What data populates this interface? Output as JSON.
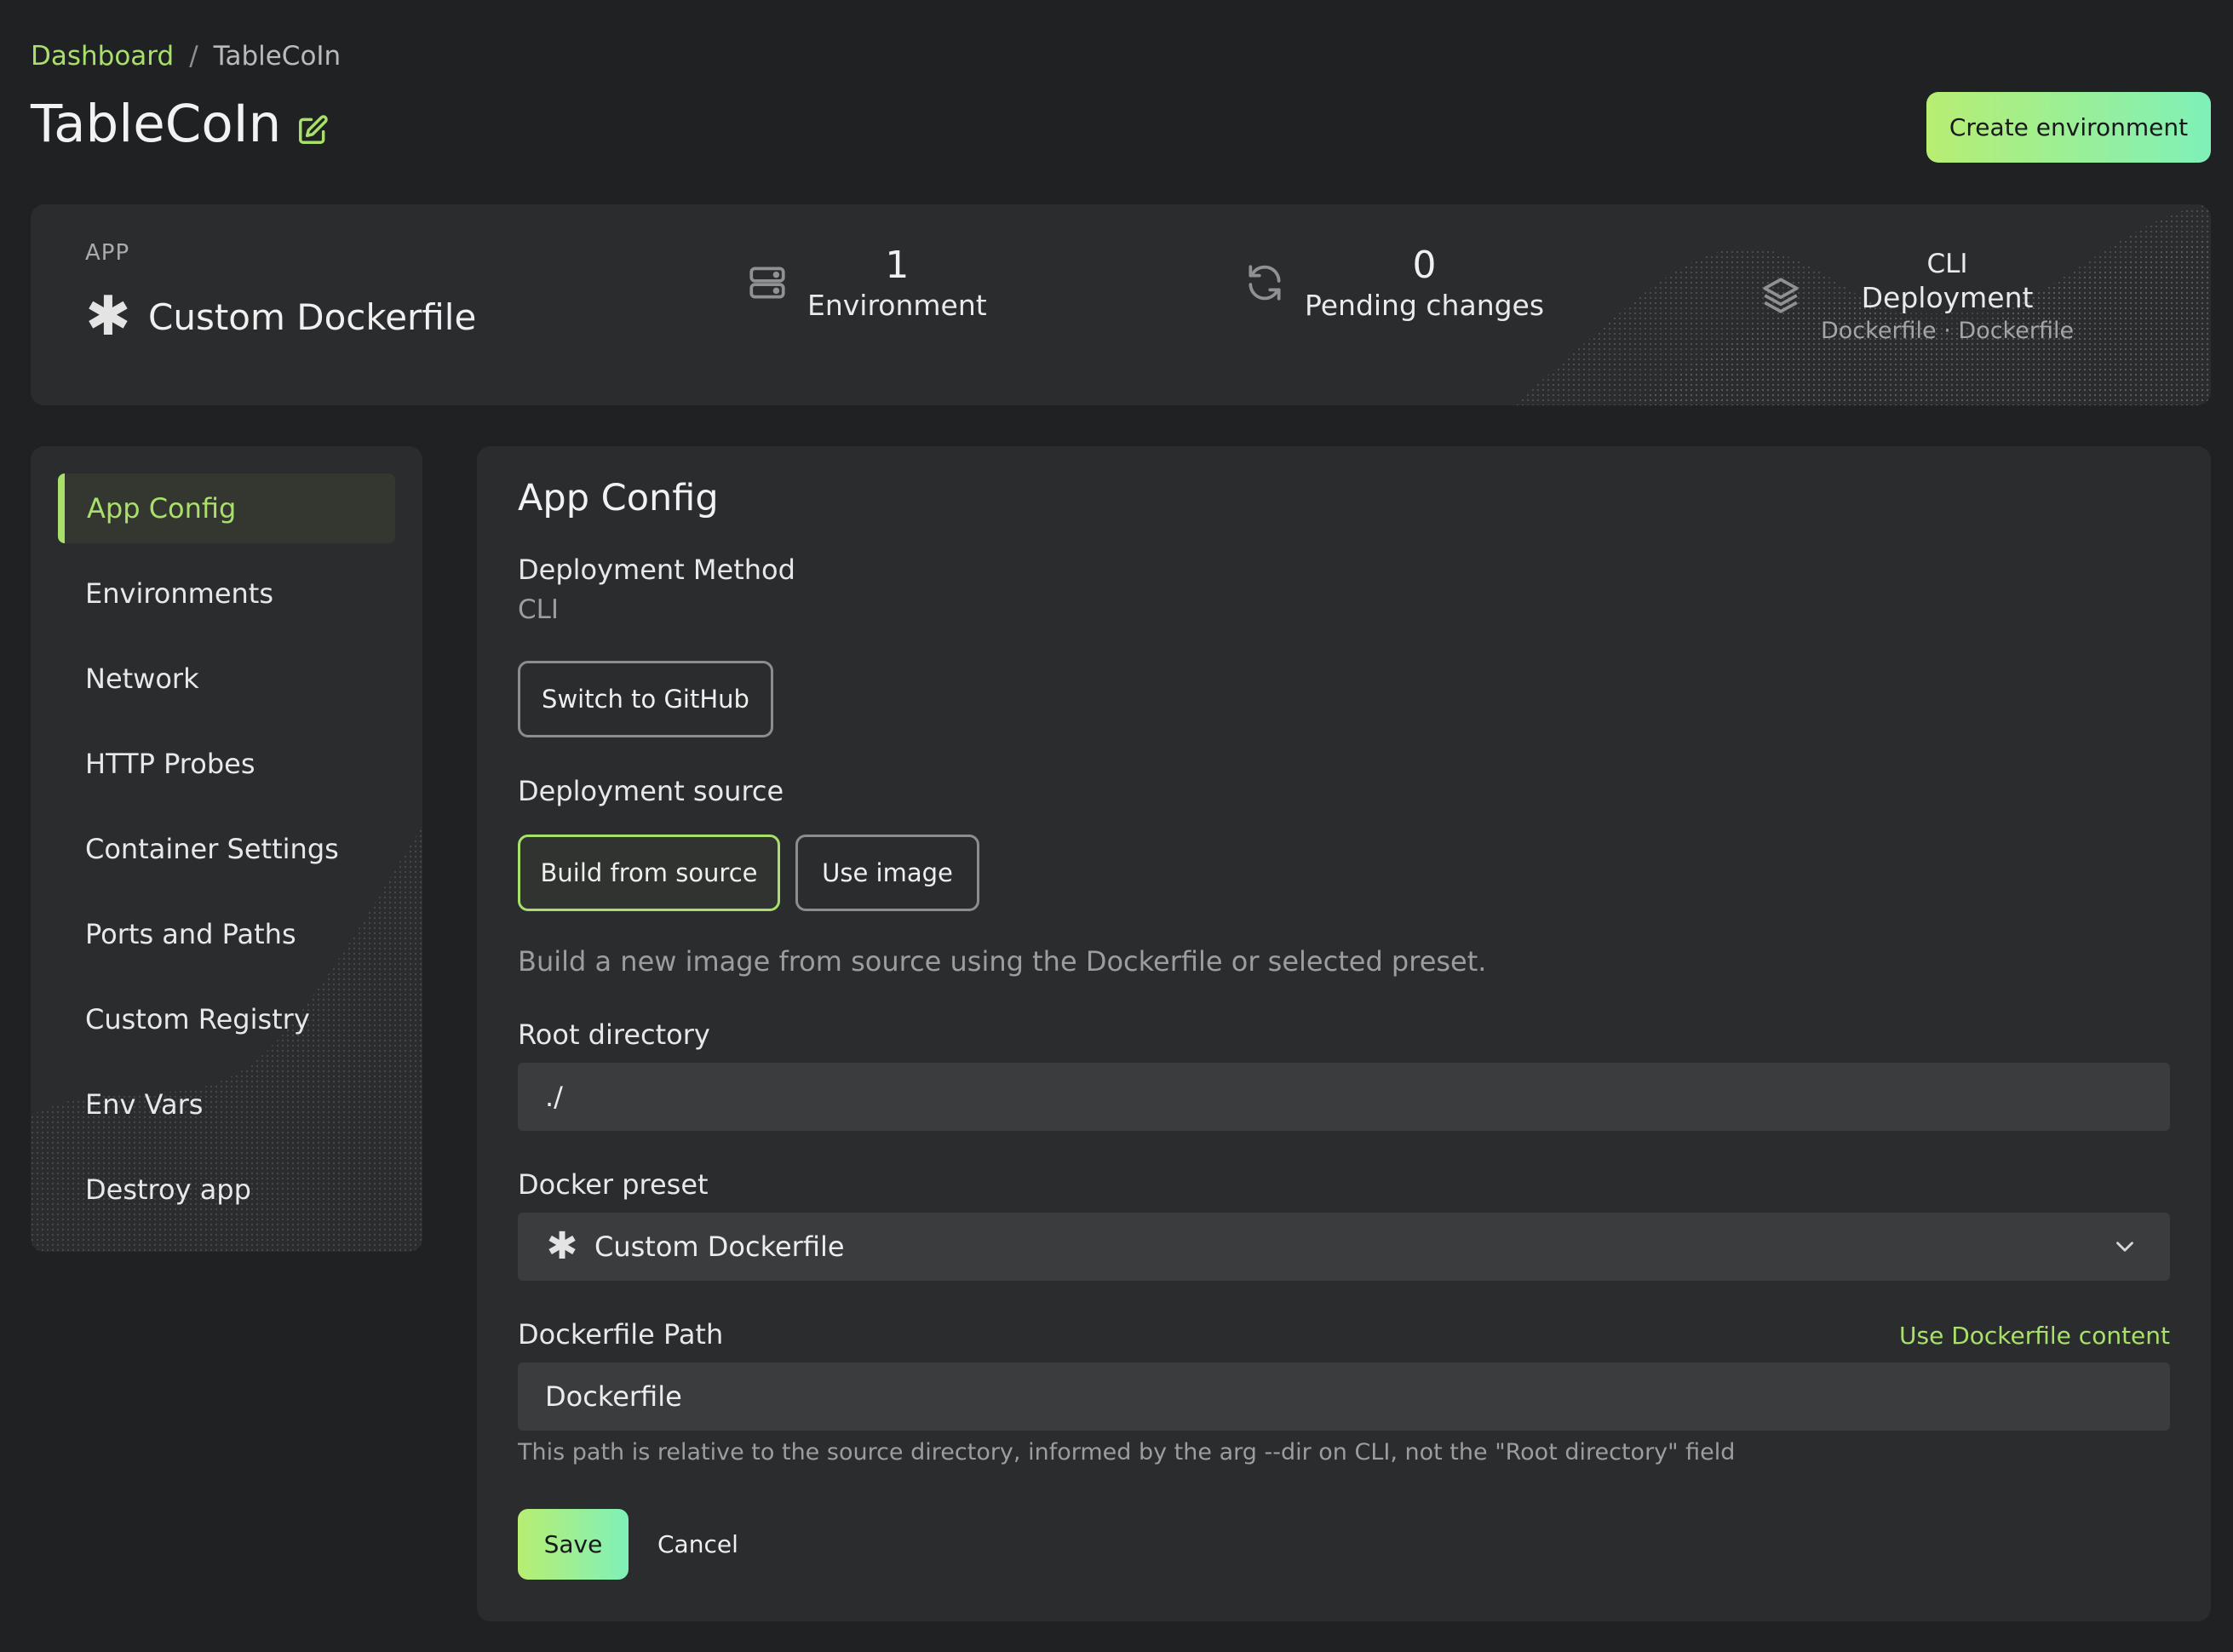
{
  "breadcrumb": {
    "root": "Dashboard",
    "separator": "/",
    "current": "TableCoIn"
  },
  "page": {
    "title": "TableCoIn"
  },
  "header": {
    "create_button": "Create environment"
  },
  "summary": {
    "app_label": "APP",
    "app_name": "Custom Dockerfile",
    "environments": {
      "value": "1",
      "label": "Environment"
    },
    "pending": {
      "value": "0",
      "label": "Pending changes"
    },
    "deployment": {
      "value": "CLI",
      "label": "Deployment",
      "sub": "Dockerfile · Dockerfile"
    }
  },
  "sidebar": {
    "items": [
      {
        "label": "App Config",
        "active": true
      },
      {
        "label": "Environments"
      },
      {
        "label": "Network"
      },
      {
        "label": "HTTP Probes"
      },
      {
        "label": "Container Settings"
      },
      {
        "label": "Ports and Paths"
      },
      {
        "label": "Custom Registry"
      },
      {
        "label": "Env Vars"
      },
      {
        "label": "Destroy app"
      }
    ]
  },
  "main": {
    "title": "App Config",
    "deployment_method": {
      "label": "Deployment Method",
      "value": "CLI",
      "switch_button": "Switch to GitHub"
    },
    "deployment_source": {
      "label": "Deployment source",
      "build_button": "Build from source",
      "image_button": "Use image",
      "description": "Build a new image from source using the Dockerfile or selected preset."
    },
    "root_directory": {
      "label": "Root directory",
      "value": "./"
    },
    "docker_preset": {
      "label": "Docker preset",
      "value": "Custom Dockerfile"
    },
    "dockerfile_path": {
      "label": "Dockerfile Path",
      "link": "Use Dockerfile content",
      "value": "Dockerfile",
      "help": "This path is relative to the source directory, informed by the arg --dir on CLI, not the \"Root directory\" field"
    },
    "actions": {
      "save": "Save",
      "cancel": "Cancel"
    }
  },
  "colors": {
    "accent": "#a8e06b",
    "gradient_end": "#7ff0b9",
    "background": "#1f2123",
    "card": "#2a2c2e"
  }
}
